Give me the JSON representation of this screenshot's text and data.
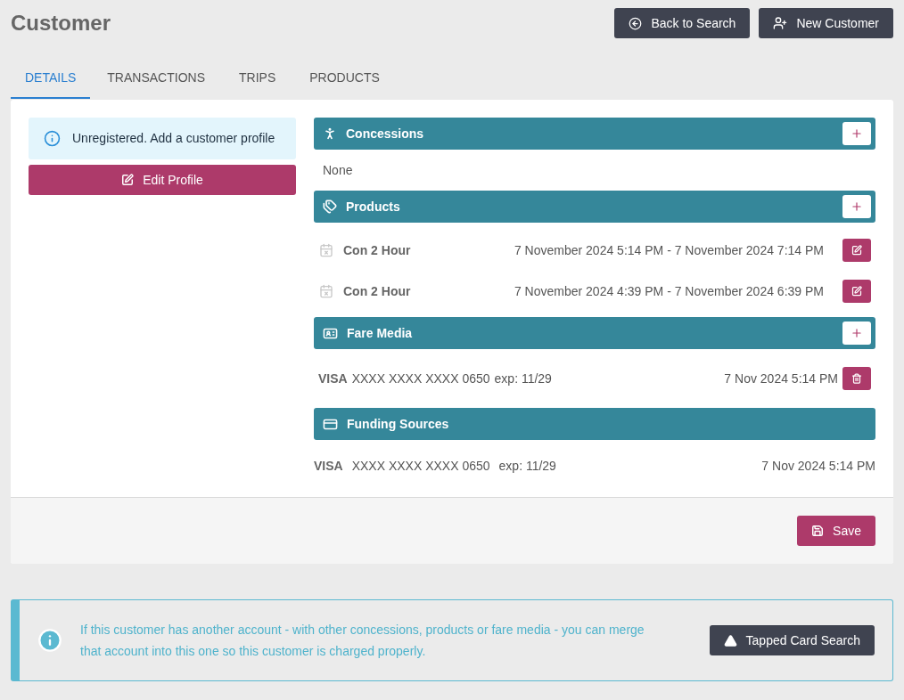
{
  "page": {
    "title": "Customer"
  },
  "header_buttons": [
    {
      "kind": "back",
      "label": "Back to Search"
    },
    {
      "kind": "new",
      "label": "New Customer"
    }
  ],
  "tabs": [
    {
      "label": "DETAILS",
      "selected": true
    },
    {
      "label": "TRANSACTIONS",
      "selected": false
    },
    {
      "label": "TRIPS",
      "selected": false
    },
    {
      "label": "PRODUCTS",
      "selected": false
    }
  ],
  "notice": {
    "text": "Unregistered. Add a customer profile"
  },
  "edit_profile_button": {
    "label": "Edit Profile"
  },
  "sections": [
    {
      "kind": "concessions",
      "title": "Concessions",
      "has_add": true,
      "empty_text": "None"
    },
    {
      "kind": "products",
      "title": "Products",
      "has_add": true,
      "items": [
        {
          "name": "Con 2 Hour",
          "period": "7 November 2024 5:14 PM - 7 November 2024 7:14 PM"
        },
        {
          "name": "Con 2 Hour",
          "period": "7 November 2024 4:39 PM - 7 November 2024 6:39 PM"
        }
      ]
    },
    {
      "kind": "fare_media",
      "title": "Fare Media",
      "has_add": true,
      "items": [
        {
          "brand": "VISA",
          "number": "XXXX XXXX XXXX 0650",
          "expiry": "exp: 11/29",
          "date": "7 Nov 2024 5:14 PM"
        }
      ]
    },
    {
      "kind": "funding_sources",
      "title": "Funding Sources",
      "has_add": false,
      "items": [
        {
          "brand": "VISA",
          "number": "XXXX XXXX XXXX 0650",
          "expiry": "exp: 11/29",
          "date": "7 Nov 2024 5:14 PM"
        }
      ]
    }
  ],
  "save_button": {
    "label": "Save"
  },
  "merge_notice": {
    "text": "If this customer has another account - with other concessions, products or fare media - you can merge that account into this one so this customer is charged properly.",
    "button": "Tapped Card Search"
  }
}
